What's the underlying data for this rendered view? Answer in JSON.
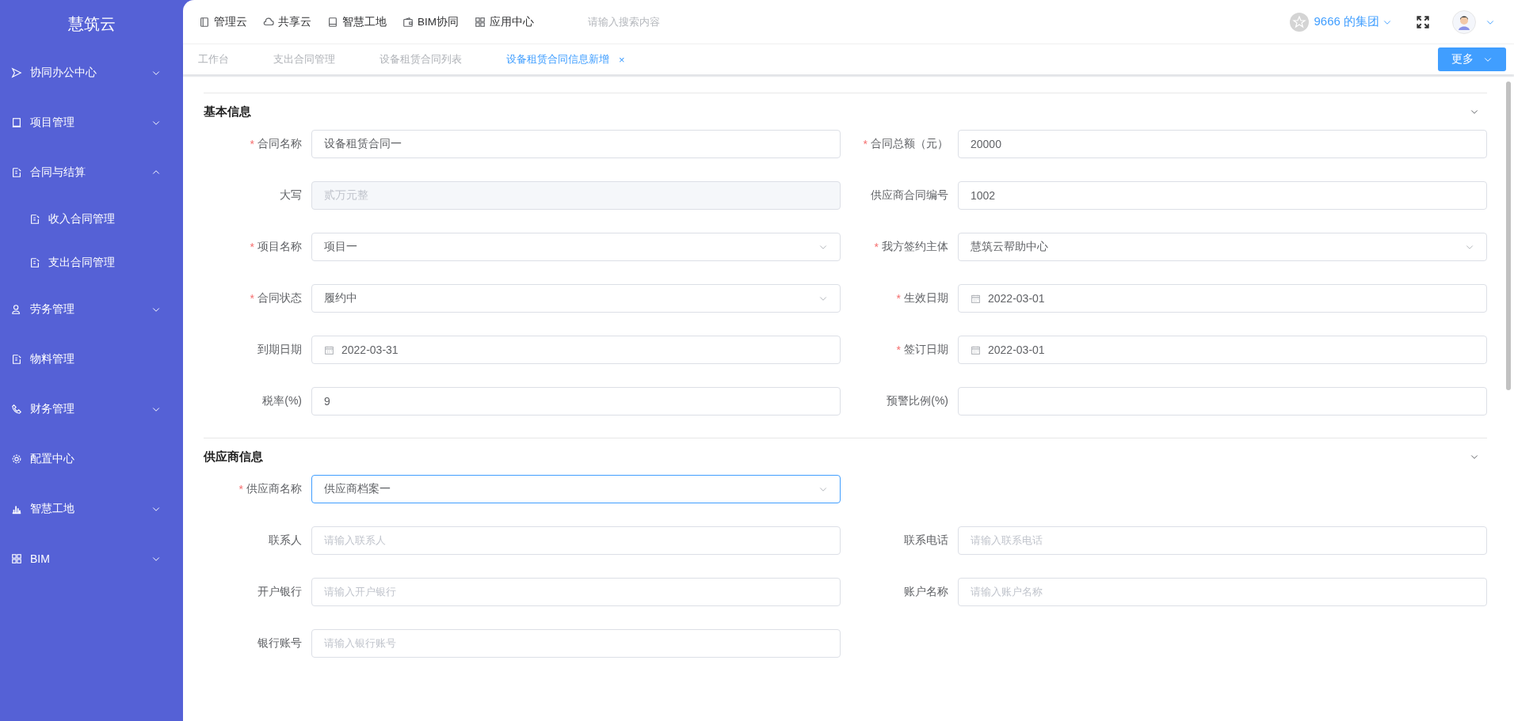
{
  "sidebar": {
    "logo": "慧筑云",
    "items": [
      {
        "label": "协同办公中心",
        "expanded": false
      },
      {
        "label": "项目管理",
        "expanded": false
      },
      {
        "label": "合同与结算",
        "expanded": true,
        "children": [
          {
            "label": "收入合同管理"
          },
          {
            "label": "支出合同管理"
          }
        ]
      },
      {
        "label": "劳务管理",
        "expanded": false
      },
      {
        "label": "物料管理"
      },
      {
        "label": "财务管理",
        "expanded": false
      },
      {
        "label": "配置中心"
      },
      {
        "label": "智慧工地",
        "expanded": false
      },
      {
        "label": "BIM",
        "expanded": false
      }
    ]
  },
  "top_nav": {
    "links": [
      {
        "label": "管理云"
      },
      {
        "label": "共享云"
      },
      {
        "label": "智慧工地"
      },
      {
        "label": "BIM协同"
      },
      {
        "label": "应用中心"
      }
    ],
    "search": {
      "placeholder": "请输入搜索内容"
    },
    "org": "9666 的集团"
  },
  "tabs": [
    {
      "label": "工作台",
      "selected": false
    },
    {
      "label": "支出合同管理",
      "selected": false
    },
    {
      "label": "设备租赁合同列表",
      "selected": false
    },
    {
      "label": "设备租赁合同信息新增",
      "selected": true,
      "close": "×"
    }
  ],
  "more_button": "更多",
  "sections": [
    {
      "title": "基本信息",
      "rows": [
        [
          {
            "label": "合同名称",
            "required_mark": "*",
            "kind": "input",
            "value": "设备租赁合同一",
            "focused": false
          },
          {
            "label": "合同总额（元）",
            "required_mark": "*",
            "kind": "input",
            "value": "20000",
            "focused": false
          }
        ],
        [
          {
            "label": "大写",
            "kind": "disabled",
            "value": "贰万元整",
            "focused": false
          },
          {
            "label": "供应商合同编号",
            "kind": "input",
            "value": "1002",
            "focused": false
          }
        ],
        [
          {
            "label": "项目名称",
            "required_mark": "*",
            "kind": "select",
            "value": "项目一",
            "focused": false
          },
          {
            "label": "我方签约主体",
            "required_mark": "*",
            "kind": "select",
            "value": "慧筑云帮助中心",
            "focused": false
          }
        ],
        [
          {
            "label": "合同状态",
            "required_mark": "*",
            "kind": "select",
            "value": "履约中",
            "focused": false
          },
          {
            "label": "生效日期",
            "required_mark": "*",
            "kind": "date",
            "value": "2022-03-01",
            "focused": false
          }
        ],
        [
          {
            "label": "到期日期",
            "kind": "date",
            "value": "2022-03-31",
            "focused": false
          },
          {
            "label": "签订日期",
            "required_mark": "*",
            "kind": "date",
            "value": "2022-03-01",
            "focused": false
          }
        ],
        [
          {
            "label": "税率(%)",
            "kind": "input",
            "value": "9",
            "focused": false
          },
          {
            "label": "预警比例(%)",
            "kind": "input",
            "focused": false
          }
        ]
      ]
    },
    {
      "title": "供应商信息",
      "rows": [
        [
          {
            "label": "供应商名称",
            "required_mark": "*",
            "kind": "select",
            "value": "供应商档案一",
            "focused": true
          }
        ],
        [
          {
            "label": "联系人",
            "kind": "input",
            "placeholder": "请输入联系人",
            "focused": false
          },
          {
            "label": "联系电话",
            "kind": "input",
            "placeholder": "请输入联系电话",
            "focused": false
          }
        ],
        [
          {
            "label": "开户银行",
            "kind": "input",
            "placeholder": "请输入开户银行",
            "focused": false
          },
          {
            "label": "账户名称",
            "kind": "input",
            "placeholder": "请输入账户名称",
            "focused": false
          }
        ],
        [
          {
            "label": "银行账号",
            "kind": "input",
            "placeholder": "请输入银行账号",
            "focused": false
          }
        ]
      ]
    }
  ]
}
